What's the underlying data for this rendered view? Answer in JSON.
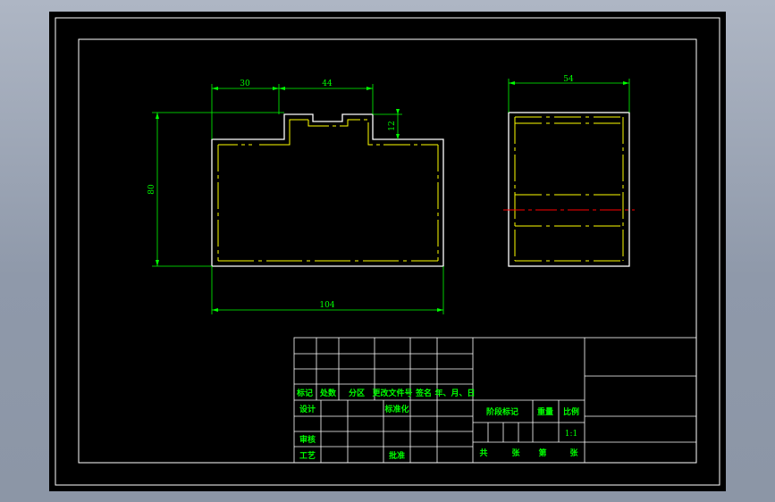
{
  "drawing": {
    "colors": {
      "background": "#000000",
      "border": "#ffffff",
      "dimension": "#00ff00",
      "outline": "#ffffff",
      "hidden": "#ffff00",
      "centerline": "#ff0000"
    },
    "front_view": {
      "dims": {
        "top_left": "30",
        "top_right": "44",
        "step": "12",
        "height": "80",
        "width": "104"
      }
    },
    "side_view": {
      "dims": {
        "width": "54"
      }
    }
  },
  "title_block": {
    "header_row": [
      "标记",
      "处数",
      "分区",
      "更改文件号",
      "签名",
      "年、月、日"
    ],
    "design": "设计",
    "standardization": "标准化",
    "review": "审核",
    "process": "工艺",
    "approve": "批准",
    "stage_mark": "阶段标记",
    "weight": "重量",
    "scale_label": "比例",
    "scale_value": "1:1",
    "total": "共",
    "sheets": "张",
    "number": "第",
    "sheet": "张"
  }
}
